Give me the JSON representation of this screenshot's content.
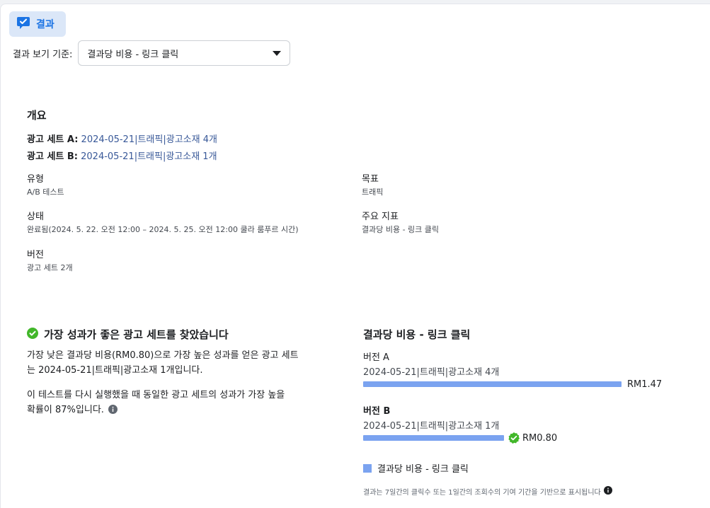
{
  "tab": {
    "label": "결과",
    "icon": "checklist-chat-icon"
  },
  "filter": {
    "label": "결과 보기 기준:",
    "selected": "결과당 비용 - 링크 클릭"
  },
  "overview": {
    "title": "개요",
    "adset_a_label": "광고 세트 A:",
    "adset_a_value": "2024-05-21|트래픽|광고소재 4개",
    "adset_b_label": "광고 세트 B:",
    "adset_b_value": "2024-05-21|트래픽|광고소재 1개",
    "type_label": "유형",
    "type_value": "A/B 테스트",
    "goal_label": "목표",
    "goal_value": "트래픽",
    "status_label": "상태",
    "status_value": "완료됨(2024. 5. 22. 오전 12:00 – 2024. 5. 25. 오전 12:00 쿨라 룸푸르 시간)",
    "metric_label": "주요 지표",
    "metric_value": "결과당 비용 - 링크 클릭",
    "version_label": "버전",
    "version_value": "광고 세트 2개"
  },
  "result": {
    "title": "가장 성과가 좋은 광고 세트를 찾았습니다",
    "para1_line1": "가장 낮은 결과당 비용(RM0.80)으로 가장 높은 성과를 얻은 광고 세트",
    "para1_line2": "는 2024-05-21|트래픽|광고소재 1개입니다.",
    "para2_line1": "이 테스트를 다시 실행했을 때 동일한 광고 세트의 성과가 가장 높을",
    "para2_line2": "확률이 87%입니다."
  },
  "chart_data": {
    "type": "bar",
    "title": "결과당 비용 - 링크 클릭",
    "series": [
      {
        "name": "결과당 비용 - 링크 클릭",
        "values": [
          1.47,
          0.8
        ]
      }
    ],
    "categories": [
      "버전 A",
      "버전 B"
    ],
    "category_subtitles": [
      "2024-05-21|트래픽|광고소재 4개",
      "2024-05-21|트래픽|광고소재 1개"
    ],
    "value_labels": [
      "RM1.47",
      "RM0.80"
    ],
    "winner_index": 1,
    "bar_color": "#7ba3f0"
  },
  "legend": {
    "label": "결과당 비용 - 링크 클릭"
  },
  "footnote": "결과는 7일간의 클릭수 또는 1일간의 조회수의 기여 기간을 기반으로 표시됩니다",
  "colors": {
    "accent": "#1b74e4",
    "link": "#385898",
    "success": "#42b72a",
    "bar": "#7ba3f0"
  }
}
